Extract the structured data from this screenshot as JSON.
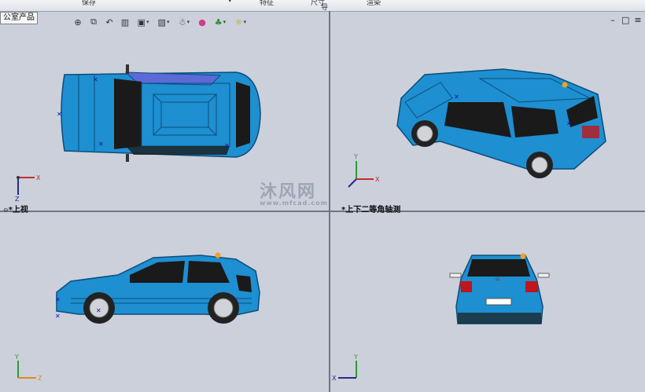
{
  "top_toolbar": {
    "fragments": [
      "保存",
      "▾",
      "特征",
      "尺寸",
      "导",
      "渲染"
    ]
  },
  "feature_tree_tab": {
    "label": "公室产品"
  },
  "heads_up_toolbar": {
    "buttons": [
      {
        "icon": "zoom-to-fit-icon",
        "glyph": "⊕"
      },
      {
        "icon": "zoom-area-icon",
        "glyph": "⧉"
      },
      {
        "icon": "previous-view-icon",
        "glyph": "↶"
      },
      {
        "icon": "section-view-icon",
        "glyph": "▥"
      },
      {
        "icon": "view-orientation-icon",
        "glyph": "▣"
      },
      {
        "icon": "display-style-icon",
        "glyph": "▧"
      },
      {
        "icon": "hide-show-items-icon",
        "glyph": "☃"
      },
      {
        "icon": "edit-appearance-icon",
        "glyph": "●"
      },
      {
        "icon": "apply-scene-icon",
        "glyph": "♣"
      },
      {
        "icon": "view-settings-icon",
        "glyph": "☼"
      }
    ]
  },
  "window_controls": [
    "–",
    "□",
    "≡"
  ],
  "viewports": {
    "top_left": {
      "label": "*上视"
    },
    "top_right": {
      "label": "*上下二等角轴测"
    },
    "bottom_left": {
      "label": ""
    },
    "bottom_right": {
      "label": ""
    }
  },
  "triad": {
    "x": "X",
    "y": "Y",
    "z": "Z"
  },
  "watermark": {
    "text": "沐风网",
    "url": "www.mfcad.com"
  },
  "colors": {
    "body": "#1e8fd1",
    "body_dark": "#0f5e94",
    "window": "#1a1a1a",
    "viewport_bg": "#cbd0db",
    "accent_orange": "#f5a020",
    "tail_red": "#c0151a"
  }
}
